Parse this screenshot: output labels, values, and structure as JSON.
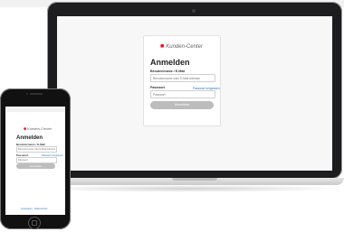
{
  "brand": {
    "name": "Kunden-Center",
    "accent": "#e30613"
  },
  "laptop_login": {
    "title": "Anmelden",
    "username_label": "Benutzername / E-Mail",
    "username_placeholder": "Benutzername oder E-Mail Adresse",
    "password_label": "Passwort",
    "forgot_link": "Passwort vergessen",
    "password_placeholder": "Passwort",
    "submit_label": "Anmelden"
  },
  "phone_login": {
    "title": "Anmelden",
    "username_label": "Benutzername / E-Mail",
    "username_placeholder": "Benutzername oder E-Mail Adresse",
    "password_label": "Passwort",
    "forgot_link": "Passwort vergessen",
    "password_placeholder": "Passwort",
    "submit_label": "Anmelden",
    "footer_link": "Impressum · Datenschutz"
  }
}
